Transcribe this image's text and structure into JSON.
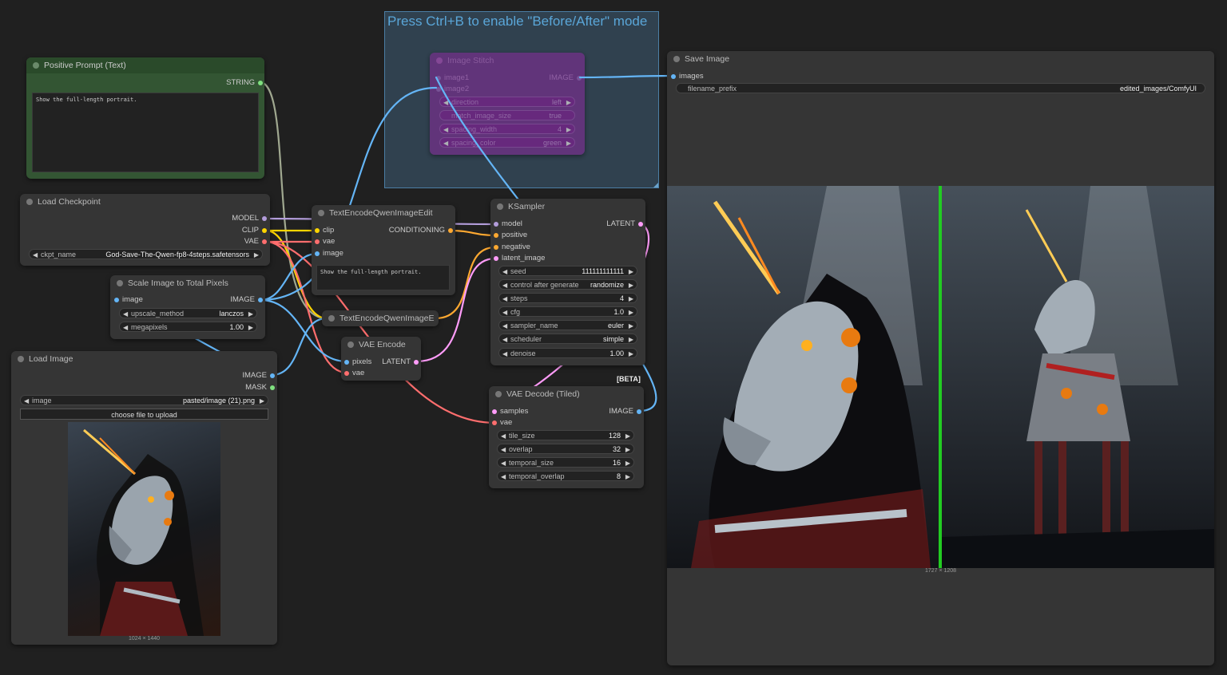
{
  "group": {
    "title": "Press Ctrl+B to enable \"Before/After\" mode"
  },
  "colors": {
    "clip": "#ffd500",
    "vae": "#ff6e6e",
    "model": "#b39ddb",
    "image": "#64b5f6",
    "latent": "#ff9cf9",
    "conditioning": "#ffa931",
    "string": "#7fe07f"
  },
  "positive_prompt": {
    "title": "Positive Prompt (Text)",
    "out": "STRING",
    "text": "Show the full-length portrait."
  },
  "load_checkpoint": {
    "title": "Load Checkpoint",
    "outs": [
      "MODEL",
      "CLIP",
      "VAE"
    ],
    "ckpt_label": "ckpt_name",
    "ckpt_value": "God-Save-The-Qwen-fp8-4steps.safetensors"
  },
  "scale_image": {
    "title": "Scale Image to Total Pixels",
    "in": "image",
    "out": "IMAGE",
    "w1_label": "upscale_method",
    "w1_value": "lanczos",
    "w2_label": "megapixels",
    "w2_value": "1.00"
  },
  "load_image": {
    "title": "Load Image",
    "outs": [
      "IMAGE",
      "MASK"
    ],
    "image_label": "image",
    "image_value": "pasted/image (21).png",
    "upload": "choose file to upload",
    "dims": "1024 × 1440",
    "preview_icon": "unicorn-robot-image"
  },
  "image_stitch": {
    "title": "Image Stitch",
    "ins": [
      "image1",
      "image2"
    ],
    "out": "IMAGE",
    "widgets": [
      {
        "label": "direction",
        "value": "left"
      },
      {
        "label": "match_image_size",
        "value": "true"
      },
      {
        "label": "spacing_width",
        "value": "4"
      },
      {
        "label": "spacing_color",
        "value": "green"
      }
    ]
  },
  "text_encode_1": {
    "title": "TextEncodeQwenImageEdit",
    "ins": [
      "clip",
      "vae",
      "image"
    ],
    "out": "CONDITIONING",
    "text": "Show the full-length portrait."
  },
  "text_encode_2": {
    "title": "TextEncodeQwenImageE"
  },
  "vae_encode": {
    "title": "VAE Encode",
    "ins": [
      "pixels",
      "vae"
    ],
    "out": "LATENT"
  },
  "ksampler": {
    "title": "KSampler",
    "ins": [
      "model",
      "positive",
      "negative",
      "latent_image"
    ],
    "out": "LATENT",
    "widgets": [
      {
        "label": "seed",
        "value": "111111111111"
      },
      {
        "label": "control after generate",
        "value": "randomize"
      },
      {
        "label": "steps",
        "value": "4"
      },
      {
        "label": "cfg",
        "value": "1.0"
      },
      {
        "label": "sampler_name",
        "value": "euler"
      },
      {
        "label": "scheduler",
        "value": "simple"
      },
      {
        "label": "denoise",
        "value": "1.00"
      }
    ]
  },
  "vae_decode": {
    "title": "VAE Decode (Tiled)",
    "badge": "[BETA]",
    "ins": [
      "samples",
      "vae"
    ],
    "out": "IMAGE",
    "widgets": [
      {
        "label": "tile_size",
        "value": "128"
      },
      {
        "label": "overlap",
        "value": "32"
      },
      {
        "label": "temporal_size",
        "value": "16"
      },
      {
        "label": "temporal_overlap",
        "value": "8"
      }
    ]
  },
  "save_image": {
    "title": "Save Image",
    "in": "images",
    "prefix_label": "filename_prefix",
    "prefix_value": "edited_images/ComfyUI",
    "dims": "1727 × 1208"
  }
}
